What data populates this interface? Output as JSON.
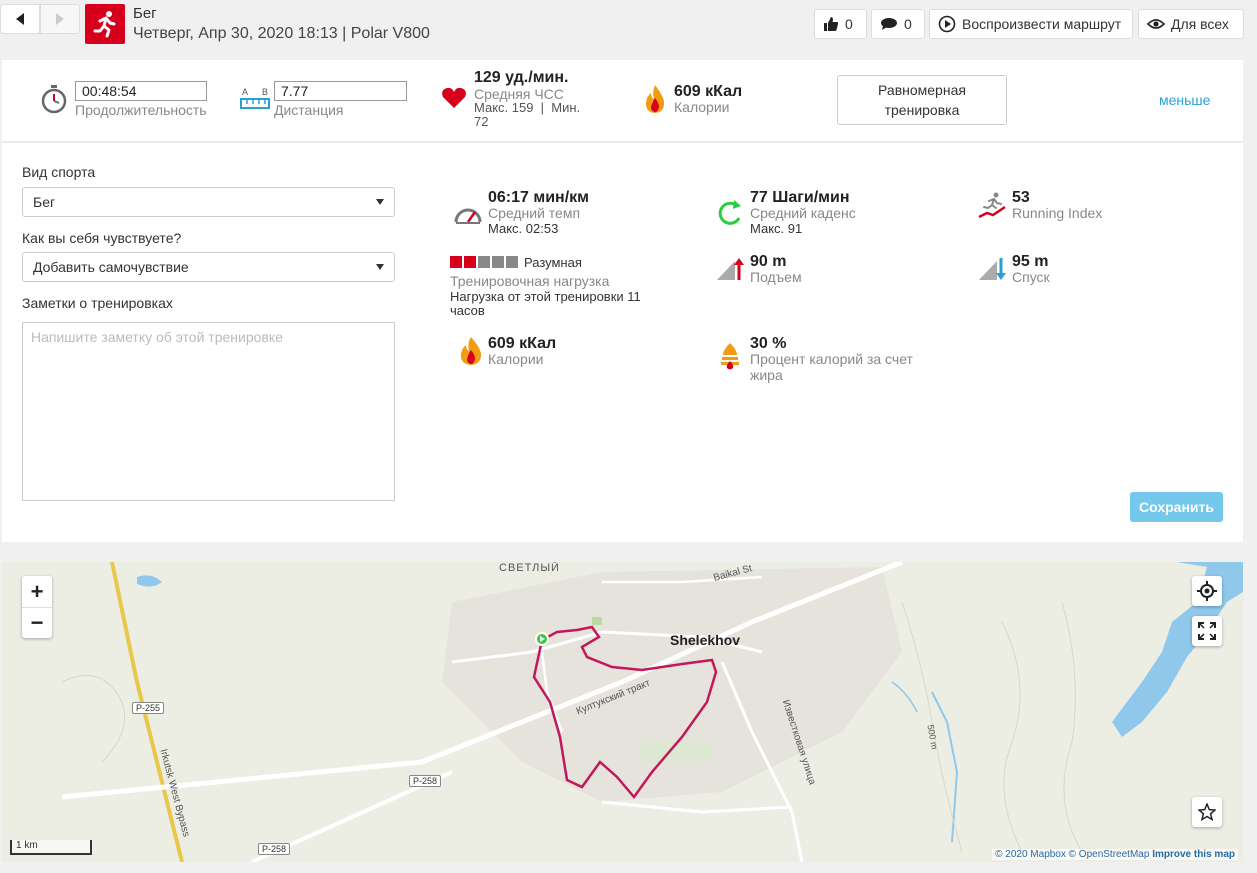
{
  "header": {
    "title": "Бег",
    "subtitle": "Четверг, Апр 30, 2020 18:13 | Polar V800",
    "likes_count": "0",
    "comments_count": "0",
    "replay_label": "Воспроизвести маршрут",
    "visibility_label": "Для всех"
  },
  "summary": {
    "duration_value": "00:48:54",
    "duration_label": "Продолжительность",
    "distance_a": "A",
    "distance_b": "B",
    "distance_value": "7.77",
    "distance_label": "Дистанция",
    "hr_value": "129 уд./мин.",
    "hr_label": "Средняя ЧСС",
    "hr_minmax_1": "Макс. 159  |  Мин.",
    "hr_minmax_2": "72",
    "calories_value": "609 кКал",
    "calories_label": "Калории",
    "training_button_line1": "Равномерная",
    "training_button_line2": "тренировка",
    "less_link": "меньше"
  },
  "form": {
    "sport_label": "Вид спорта",
    "sport_value": "Бег",
    "feeling_label": "Как вы себя чувствуете?",
    "feeling_value": "Добавить самочувствие",
    "notes_label": "Заметки о тренировках",
    "notes_placeholder": "Напишите заметку об этой тренировке",
    "save_label": "Сохранить"
  },
  "stats": {
    "pace_value": "06:17 мин/км",
    "pace_label": "Средний темп",
    "pace_max": "Макс. 02:53",
    "cadence_value": "77 Шаги/мин",
    "cadence_label": "Средний каденс",
    "cadence_max": "Макс. 91",
    "running_index_value": "53",
    "running_index_label": "Running Index",
    "load_rating": "Разумная",
    "load_label": "Тренировочная нагрузка",
    "load_sub_1": "Нагрузка от этой тренировки 11",
    "load_sub_2": "часов",
    "load_filled": 2,
    "load_total": 5,
    "ascent_value": "90 m",
    "ascent_label": "Подъем",
    "descent_value": "95 m",
    "descent_label": "Спуск",
    "calories_value": "609 кКал",
    "calories_label": "Калории",
    "fat_value": "30 %",
    "fat_label_1": "Процент калорий за счет",
    "fat_label_2": "жира"
  },
  "map": {
    "place_svetly": "СВЕТЛЫЙ",
    "place_shelekhov": "Shelekhov",
    "street_baikal": "Baikal St",
    "street_kultuk": "Култукский тракт",
    "street_izvest": "Известковая улица",
    "bypass": "Irkutsk West Bypass",
    "road_p255": "Р-255",
    "road_p258a": "Р-258",
    "road_p258b": "Р-258",
    "contour": "500 m",
    "scale_label": "1 km",
    "attr_mapbox": "© 2020 Mapbox",
    "attr_osm": "© OpenStreetMap",
    "attr_improve": "Improve this map",
    "zoom_in": "+",
    "zoom_out": "−"
  },
  "colors": {
    "brand_red": "#d6001c",
    "link_blue": "#2a9fd6",
    "save_blue": "#74c8ec",
    "route": "#c2185b"
  }
}
